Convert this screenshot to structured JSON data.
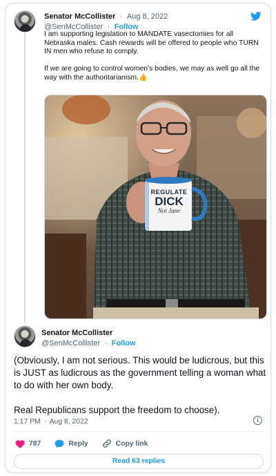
{
  "tweet1": {
    "name": "Senator McCollister",
    "separator": "·",
    "date": "Aug 8, 2022",
    "handle": "@SenMcCollister",
    "follow": "Follow",
    "text": "I am supporting legislation to MANDATE vasectomies for all Nebraska males. Cash rewards will be offered to people who TURN IN men who refuse to comply.\n\nIf we are going to control women's bodies, we may as well go all the way with the authoritarianism.👍",
    "mug_text": {
      "line1": "REGULATE",
      "line2": "DICK",
      "line3": "Not Jane"
    }
  },
  "tweet2": {
    "name": "Senator McCollister",
    "handle": "@SenMcCollister",
    "follow": "Follow",
    "text": "(Obviously, I am not serious. This would be ludicrous, but this is JUST as ludicrous as the government telling a woman what to do with her own body.\n\nReal Republicans support the freedom to choose).",
    "time": "1:17 PM",
    "date": "Aug 8, 2022",
    "info_icon": "info-icon"
  },
  "actions": {
    "likes": "787",
    "reply": "Reply",
    "copy_link": "Copy link"
  },
  "read_replies": "Read 63 replies",
  "colors": {
    "accent": "#1d9bf0",
    "heart": "#f91880",
    "text": "#0f1419",
    "muted": "#536471",
    "border": "#cfd9de"
  }
}
